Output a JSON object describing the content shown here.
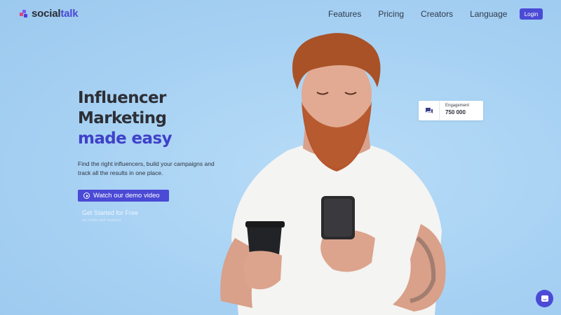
{
  "logo": {
    "prefix": "social",
    "suffix": "talk"
  },
  "nav": {
    "items": [
      {
        "label": "Features"
      },
      {
        "label": "Pricing"
      },
      {
        "label": "Creators"
      },
      {
        "label": "Language"
      }
    ],
    "login_label": "Login"
  },
  "hero": {
    "headline_line1": "Influencer",
    "headline_line2": "Marketing",
    "headline_accent": "made easy",
    "subtext": "Find the right influencers, build your campaigns and track all the results in one place.",
    "demo_button_label": "Watch our demo video",
    "cta_link": "Get Started for Free",
    "cta_note": "no credit card required"
  },
  "engagement_card": {
    "label": "Engagement",
    "value": "750 000",
    "icon": "chat-bubble-icon"
  },
  "chat_widget": {
    "icon": "chat-icon"
  },
  "colors": {
    "background": "#a9d3f5",
    "accent": "#4a4ad6",
    "headline": "#2d2f36",
    "headline_accent": "#3f41c9"
  }
}
